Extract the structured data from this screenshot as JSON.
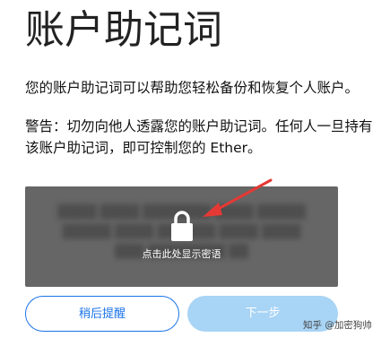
{
  "header": {
    "title": "账户助记词"
  },
  "content": {
    "intro": "您的账户助记词可以帮助您轻松备份和恢复个人账户。",
    "warning": "警告：切勿向他人透露您的账户助记词。任何人一旦持有该账户助记词，即可控制您的 Ether。"
  },
  "reveal": {
    "label": "点击此处显示密语",
    "icon": "lock-icon",
    "overlay_color": "#666666"
  },
  "buttons": {
    "later_label": "稍后提醒",
    "next_label": "下一步"
  },
  "watermark": {
    "text": "知乎 @加密狗帅"
  },
  "colors": {
    "primary": "#1a73e8",
    "disabled": "#a8d4f5",
    "arrow": "#e53935"
  }
}
